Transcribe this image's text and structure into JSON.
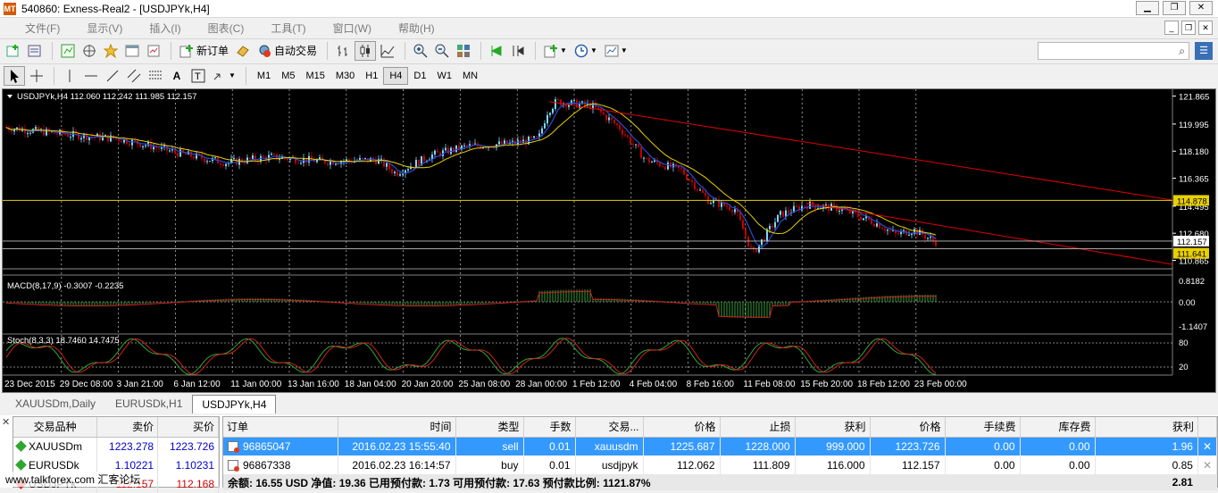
{
  "window": {
    "title": "540860: Exness-Real2 - [USDJPYk,H4]"
  },
  "menu": [
    "文件(F)",
    "显示(V)",
    "插入(I)",
    "图表(C)",
    "工具(T)",
    "窗口(W)",
    "帮助(H)"
  ],
  "toolbar": {
    "new_order_label": "新订单",
    "auto_trade_label": "自动交易",
    "timeframes": [
      "M1",
      "M5",
      "M15",
      "M30",
      "H1",
      "H4",
      "D1",
      "W1",
      "MN"
    ],
    "active_timeframe": "H4"
  },
  "chart": {
    "header": "USDJPYk,H4  112.060 112.242 111.985 112.157",
    "price_labels": [
      "121.865",
      "119.995",
      "118.180",
      "116.365",
      "114.495",
      "112.680",
      "110.865"
    ],
    "hline_label": "114.878",
    "bid_label": "112.157",
    "ask_label": "111.641",
    "macd_header": "MACD(8,17,9) -0.3007 -0.2235",
    "macd_labels": [
      "0.8182",
      "0.00",
      "-1.1407"
    ],
    "stoch_header": "Stoch(8,3,3) 18.7460 14.7475",
    "stoch_labels": [
      "80",
      "20"
    ],
    "time_labels": [
      "23 Dec 2015",
      "29 Dec 08:00",
      "3 Jan 21:00",
      "6 Jan 12:00",
      "11 Jan 00:00",
      "13 Jan 16:00",
      "18 Jan 04:00",
      "20 Jan 20:00",
      "25 Jan 08:00",
      "28 Jan 00:00",
      "1 Feb 12:00",
      "4 Feb 04:00",
      "8 Feb 16:00",
      "11 Feb 08:00",
      "15 Feb 20:00",
      "18 Feb 12:00",
      "23 Feb 00:00"
    ],
    "colors": {
      "background": "#000000",
      "bull": "#7fd7ff",
      "bear": "#c00000",
      "trend": "#e00000",
      "hline": "#e8d000",
      "ma_fast": "#2a4bd0",
      "ma_slow": "#e8d000"
    }
  },
  "chart_tabs": [
    "XAUUSDm,Daily",
    "EURUSDk,H1",
    "USDJPYk,H4"
  ],
  "active_tab": "USDJPYk,H4",
  "market_watch": {
    "headers": [
      "交易品种",
      "卖价",
      "买价"
    ],
    "rows": [
      {
        "symbol": "XAUUSDm",
        "bid": "1223.278",
        "ask": "1223.726"
      },
      {
        "symbol": "EURUSDk",
        "bid": "1.10221",
        "ask": "1.10231"
      },
      {
        "symbol": "USDJPYk",
        "bid": "112.157",
        "ask": "112.168"
      }
    ]
  },
  "orders": {
    "headers": [
      "订单",
      "时间",
      "类型",
      "手数",
      "交易...",
      "价格",
      "止损",
      "获利",
      "价格",
      "手续费",
      "库存费",
      "获利"
    ],
    "rows": [
      [
        "96865047",
        "2016.02.23 15:55:40",
        "sell",
        "0.01",
        "xauusdm",
        "1225.687",
        "1228.000",
        "999.000",
        "1223.726",
        "0.00",
        "0.00",
        "1.96"
      ],
      [
        "96867338",
        "2016.02.23 16:14:57",
        "buy",
        "0.01",
        "usdjpyk",
        "112.062",
        "111.809",
        "116.000",
        "112.157",
        "0.00",
        "0.00",
        "0.85"
      ]
    ],
    "summary": "余额: 16.55 USD  净值: 19.36  已用预付款: 1.73  可用预付款: 17.63  预付款比例: 1121.87%",
    "summary_total": "2.81"
  },
  "watermark": "www.talkforex.com 汇客论坛"
}
